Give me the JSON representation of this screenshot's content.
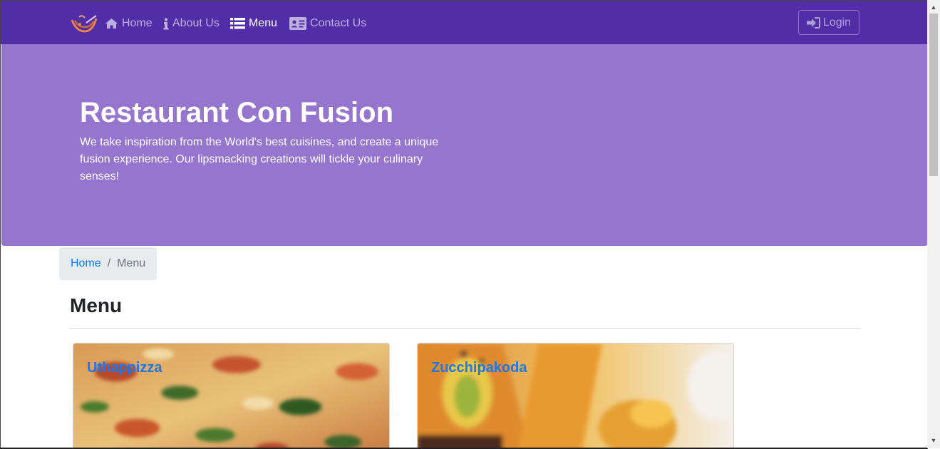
{
  "navbar": {
    "items": [
      {
        "label": "Home",
        "icon": "home-icon"
      },
      {
        "label": "About Us",
        "icon": "info-icon"
      },
      {
        "label": "Menu",
        "icon": "list-icon",
        "active": true
      },
      {
        "label": "Contact Us",
        "icon": "address-card-icon"
      }
    ],
    "login_label": "Login",
    "bg_color": "#512da8"
  },
  "jumbotron": {
    "title": "Restaurant Con Fusion",
    "text": "We take inspiration from the World's best cuisines, and create a unique fusion experience. Our lipsmacking creations will tickle your culinary senses!",
    "bg_color": "#9575cd"
  },
  "breadcrumb": {
    "home": "Home",
    "current": "Menu"
  },
  "page": {
    "title": "Menu"
  },
  "menu": {
    "dishes": [
      {
        "name": "Uthappizza"
      },
      {
        "name": "Zucchipakoda"
      }
    ]
  }
}
